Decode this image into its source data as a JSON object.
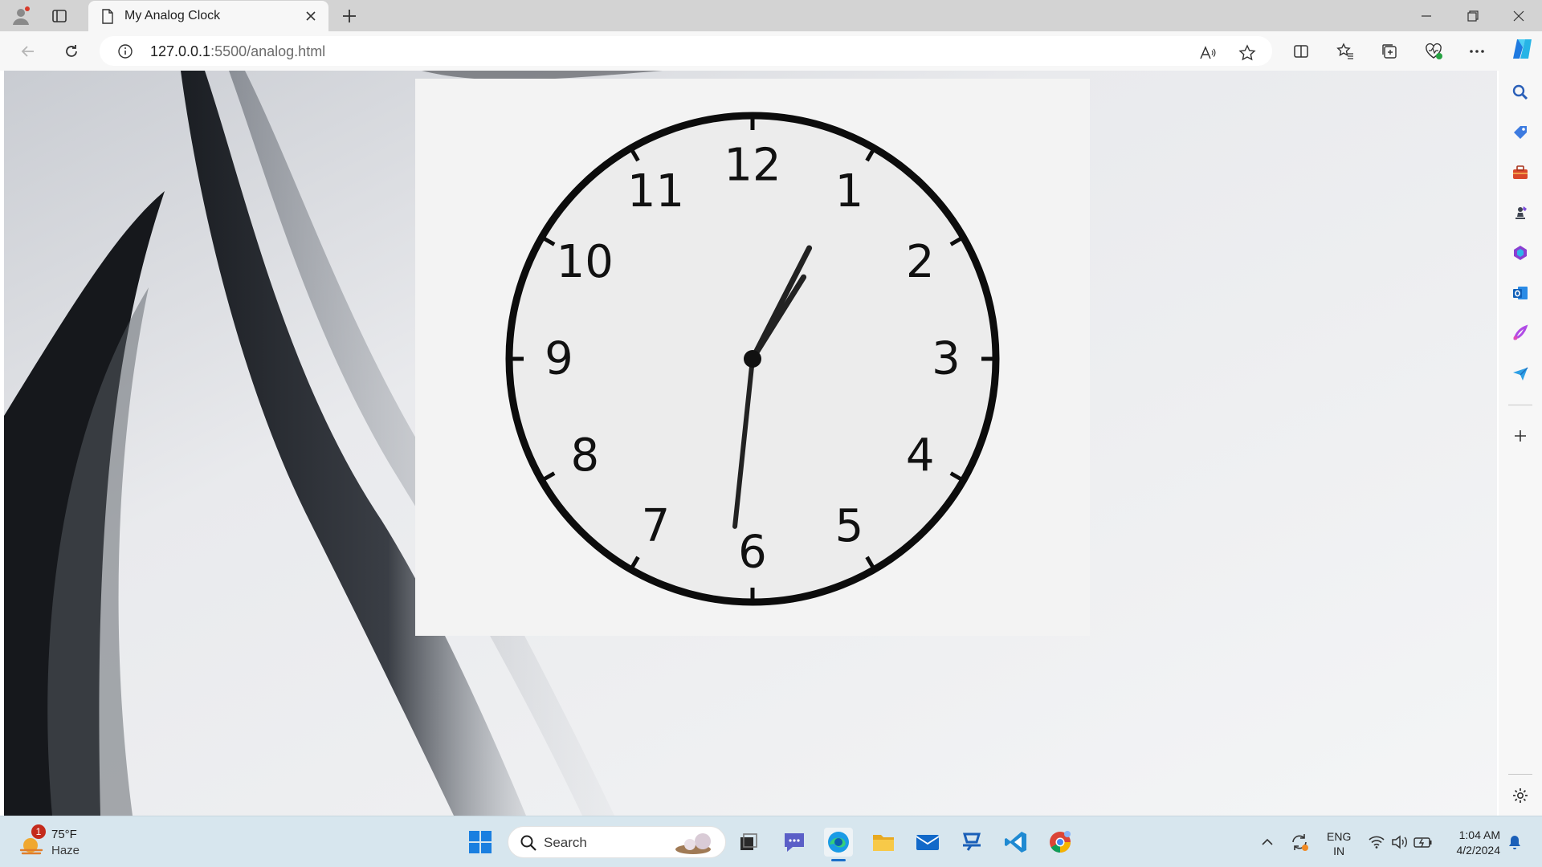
{
  "browser": {
    "tab_title": "My Analog Clock",
    "url_host": "127.0.0.1",
    "url_path": ":5500/analog.html"
  },
  "clock": {
    "numerals": [
      "12",
      "1",
      "2",
      "3",
      "4",
      "5",
      "6",
      "7",
      "8",
      "9",
      "10",
      "11"
    ],
    "hour": 1,
    "minute": 4,
    "second": 31
  },
  "taskbar": {
    "weather_temp": "75°F",
    "weather_condition": "Haze",
    "weather_badge": "1",
    "search_placeholder": "Search",
    "lang_line1": "ENG",
    "lang_line2": "IN",
    "time": "1:04 AM",
    "date": "4/2/2024"
  },
  "icons": {
    "sidebar": [
      "search-icon",
      "shopping-tag-icon",
      "toolbox-icon",
      "chess-icon",
      "microsoft365-icon",
      "outlook-icon",
      "designer-icon",
      "send-icon",
      "add-icon",
      "settings-icon"
    ],
    "pinned_apps": [
      "windows-start-icon",
      "task-view-icon",
      "teams-chat-icon",
      "edge-icon",
      "file-explorer-icon",
      "mail-icon",
      "app-icon",
      "vscode-icon",
      "chrome-icon"
    ]
  },
  "colors": {
    "titlebar": "#d3d3d3",
    "toolbar": "#f7f7f7",
    "taskbar": "#d7e6ee",
    "copilot_accent": "#1f7ae0"
  }
}
